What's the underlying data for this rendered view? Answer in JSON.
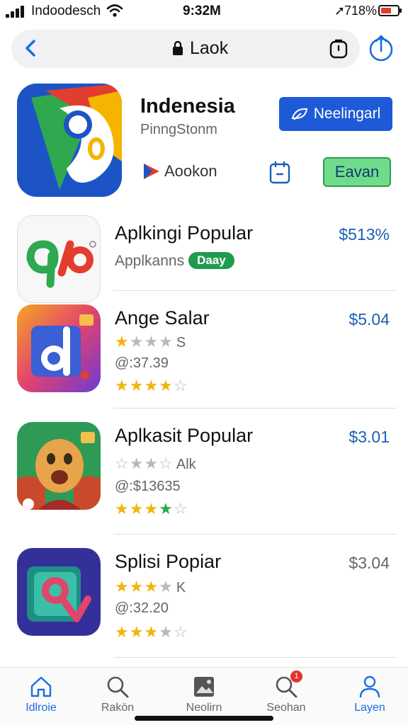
{
  "status_bar": {
    "carrier": "Indoodesсh",
    "time": "9:32M",
    "battery": "718%"
  },
  "browser": {
    "address": "Laok"
  },
  "featured": {
    "title": "Indenesia",
    "subtitle": "PinngStonm",
    "primary_button": "Neelingarl",
    "link_label": "Aookon",
    "secondary_button": "Eavan"
  },
  "apps": [
    {
      "name": "Aplkingi Popular",
      "price": "$513%",
      "subtitle": "Applkanns",
      "badge": "Daay"
    },
    {
      "name": "Ange Salar",
      "price": "$5.04",
      "rating_text": "S",
      "meta": "@:37.39",
      "rating": 4
    },
    {
      "name": "Aplkasit Popular",
      "price": "$3.01",
      "rating_text": "Alk",
      "meta": "@:$13635",
      "rating": 4
    },
    {
      "name": "Splisi Popiar",
      "price": "$3.04",
      "rating_text": "K",
      "meta": "@:32.20",
      "rating": 3
    }
  ],
  "tabs": [
    {
      "label": "Idlroie",
      "icon": "home-icon"
    },
    {
      "label": "Rakön",
      "icon": "search-icon"
    },
    {
      "label": "Neolirn",
      "icon": "image-icon"
    },
    {
      "label": "Seohan",
      "icon": "search-badge-icon",
      "badge": "1"
    },
    {
      "label": "Layen",
      "icon": "profile-icon"
    }
  ],
  "colors": {
    "accent": "#1a6ee0",
    "primary_button": "#1e5ad8",
    "green_button": "#6fdc8c",
    "price": "#1b5fb3",
    "star": "#f2b50c"
  }
}
